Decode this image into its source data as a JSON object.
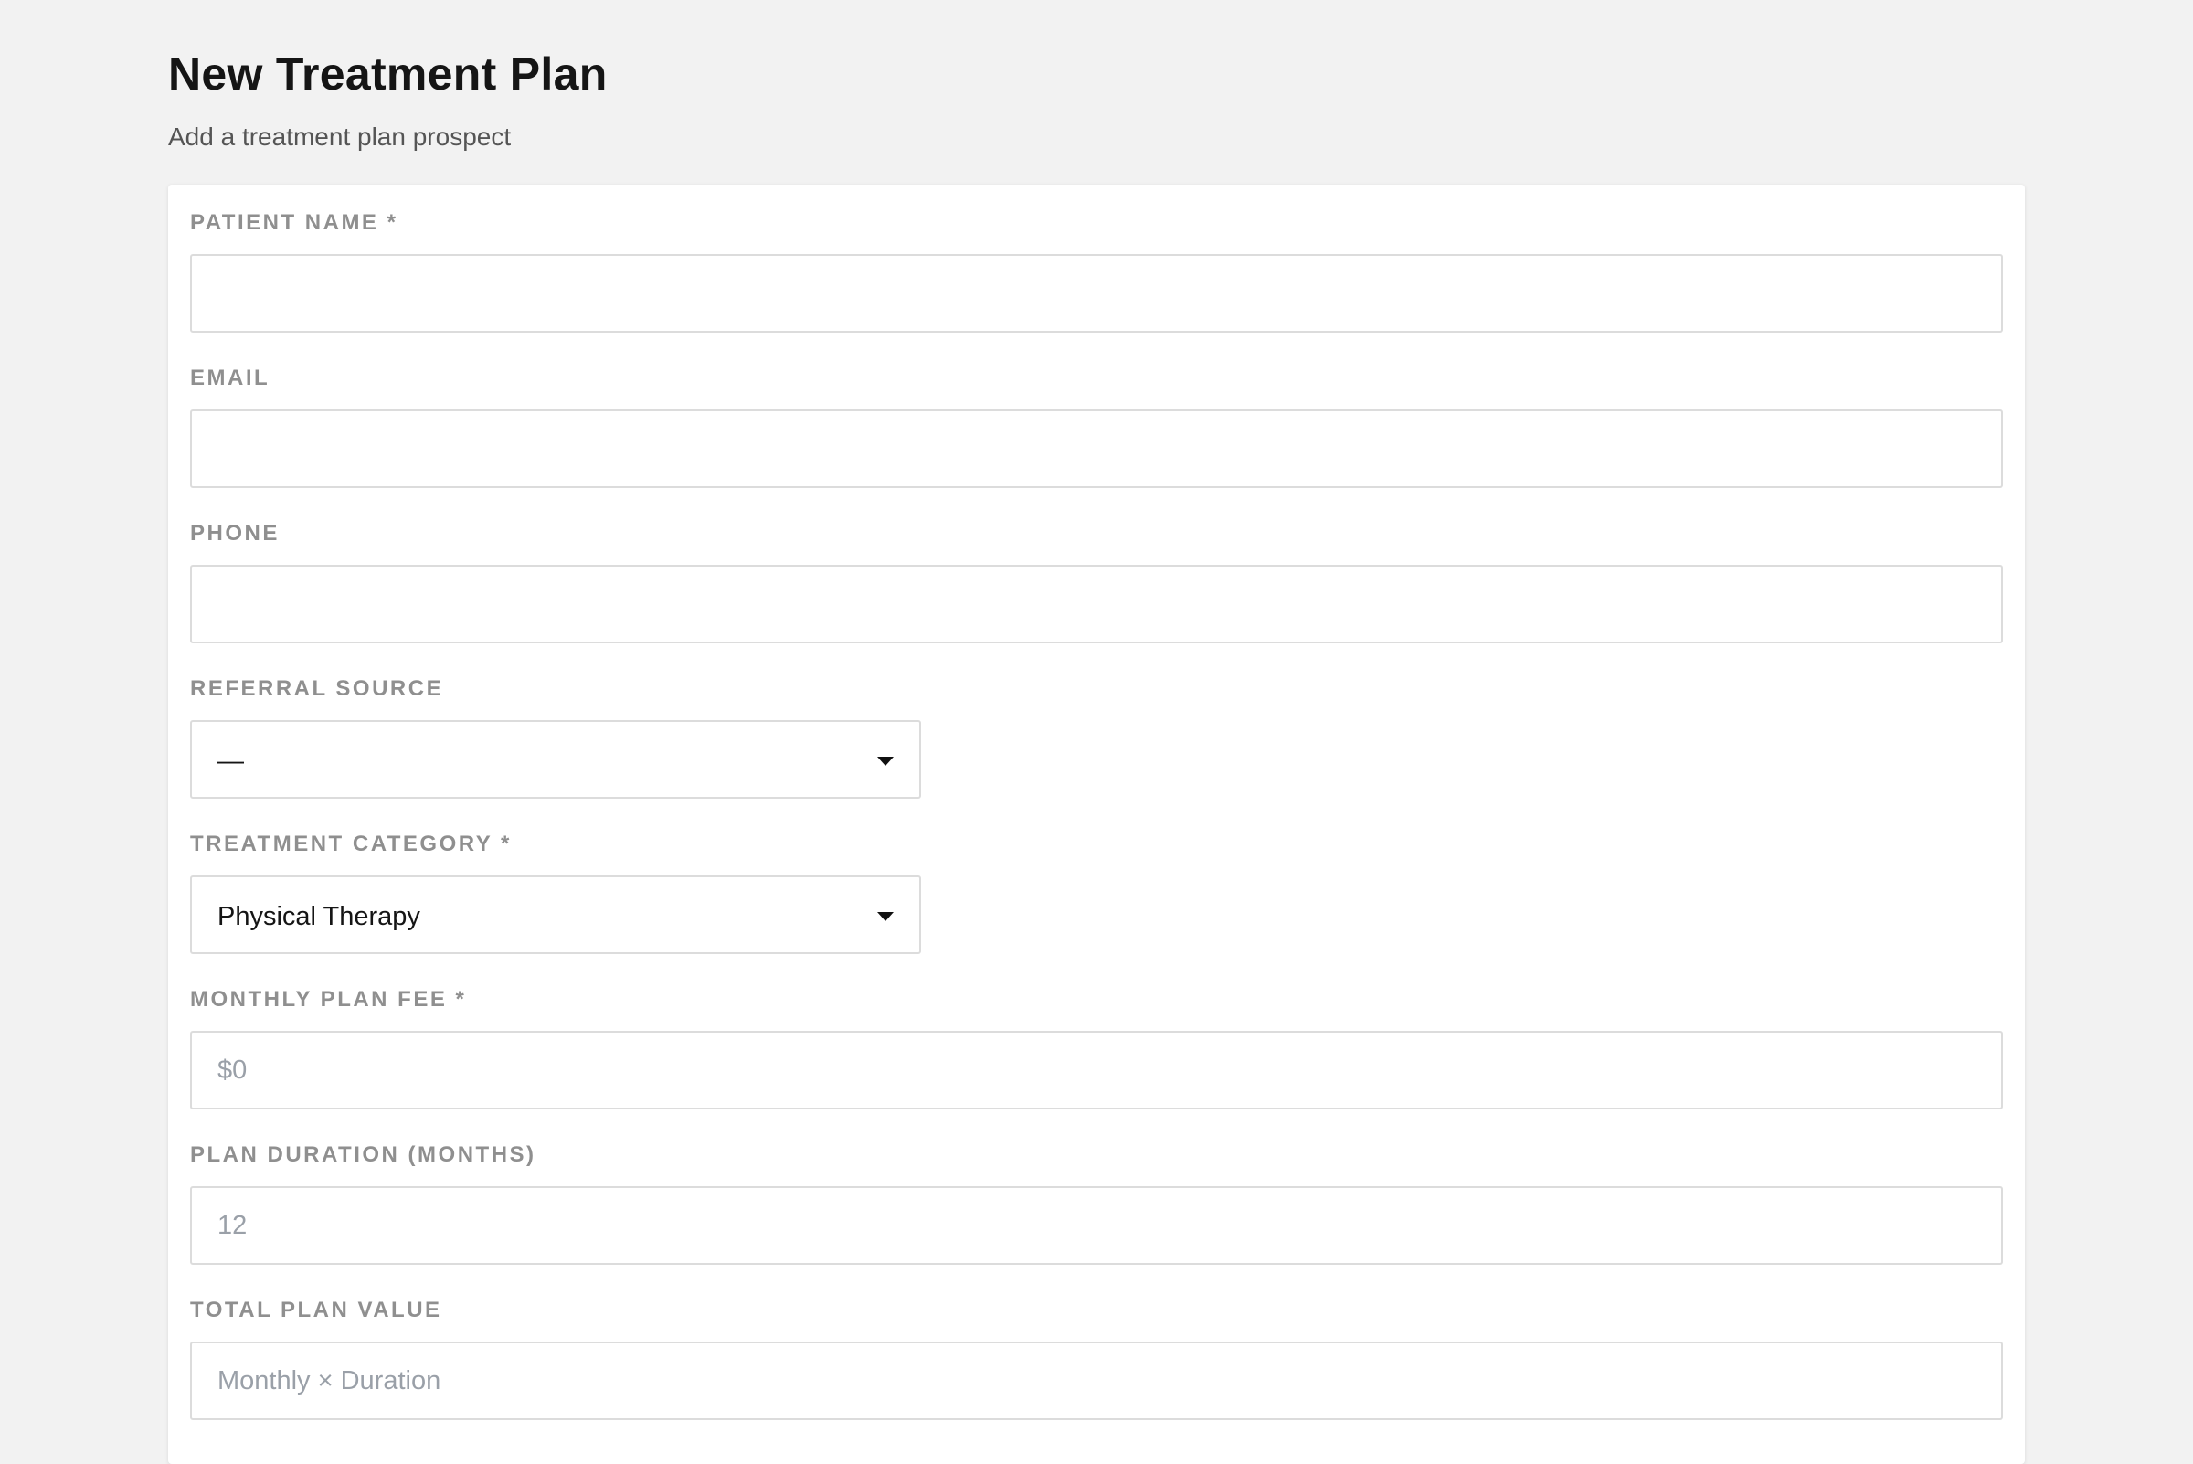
{
  "header": {
    "title": "New Treatment Plan",
    "subtitle": "Add a treatment plan prospect"
  },
  "form": {
    "patient_name": {
      "label": "PATIENT NAME *",
      "value": "",
      "placeholder": ""
    },
    "email": {
      "label": "EMAIL",
      "value": "",
      "placeholder": ""
    },
    "phone": {
      "label": "PHONE",
      "value": "",
      "placeholder": ""
    },
    "referral_source": {
      "label": "REFERRAL SOURCE",
      "selected": "—"
    },
    "treatment_category": {
      "label": "TREATMENT CATEGORY *",
      "selected": "Physical Therapy"
    },
    "monthly_plan_fee": {
      "label": "MONTHLY PLAN FEE *",
      "value": "",
      "placeholder": "$0"
    },
    "plan_duration": {
      "label": "PLAN DURATION (MONTHS)",
      "value": "",
      "placeholder": "12"
    },
    "total_plan_value": {
      "label": "TOTAL PLAN VALUE",
      "value": "",
      "placeholder": "Monthly × Duration"
    }
  },
  "icons": {
    "dropdown": "chevron-down-icon"
  }
}
